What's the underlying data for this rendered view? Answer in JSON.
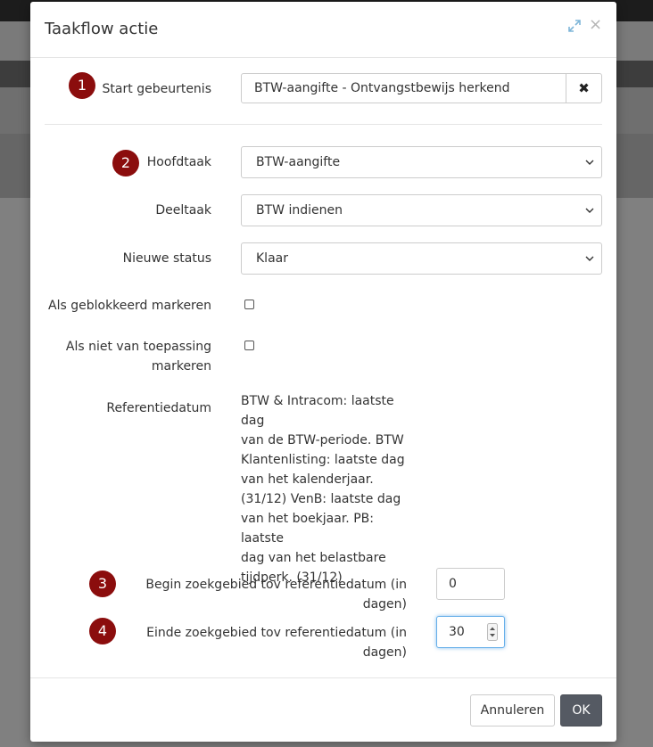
{
  "colors": {
    "badge": "#8b0d0d",
    "ok_button": "#555a63",
    "focus": "#66afe9"
  },
  "dialog": {
    "title": "Taakflow actie",
    "icons": {
      "expand": "expand-arrows-icon",
      "close": "close-icon"
    }
  },
  "form": {
    "start_event": {
      "badge": "1",
      "label": "Start gebeurtenis",
      "value": "BTW-aangifte - Ontvangstbewijs herkend",
      "clear_icon": "times-icon"
    },
    "main_task": {
      "badge": "2",
      "label": "Hoofdtaak",
      "value": "BTW-aangifte"
    },
    "sub_task": {
      "label": "Deeltaak",
      "value": "BTW indienen"
    },
    "new_status": {
      "label": "Nieuwe status",
      "value": "Klaar"
    },
    "mark_blocked": {
      "label": "Als geblokkeerd markeren",
      "checked": false
    },
    "mark_not_applicable": {
      "label_line1": "Als niet van toepassing",
      "label_line2": "markeren",
      "checked": false
    },
    "reference_date": {
      "label": "Referentiedatum",
      "lines": [
        "BTW & Intracom: laatste dag",
        "van de BTW-periode. BTW",
        "Klantenlisting: laatste dag",
        "van het kalenderjaar.",
        "(31/12) VenB: laatste dag",
        "van het boekjaar. PB: laatste",
        "dag van het belastbare",
        "tijdperk. (31/12)"
      ]
    },
    "search_start": {
      "badge": "3",
      "label": "Begin zoekgebied tov referentiedatum (in dagen)",
      "value": "0"
    },
    "search_end": {
      "badge": "4",
      "label": "Einde zoekgebied tov referentiedatum (in dagen)",
      "value": "30"
    }
  },
  "footer": {
    "cancel_label": "Annuleren",
    "ok_label": "OK"
  }
}
